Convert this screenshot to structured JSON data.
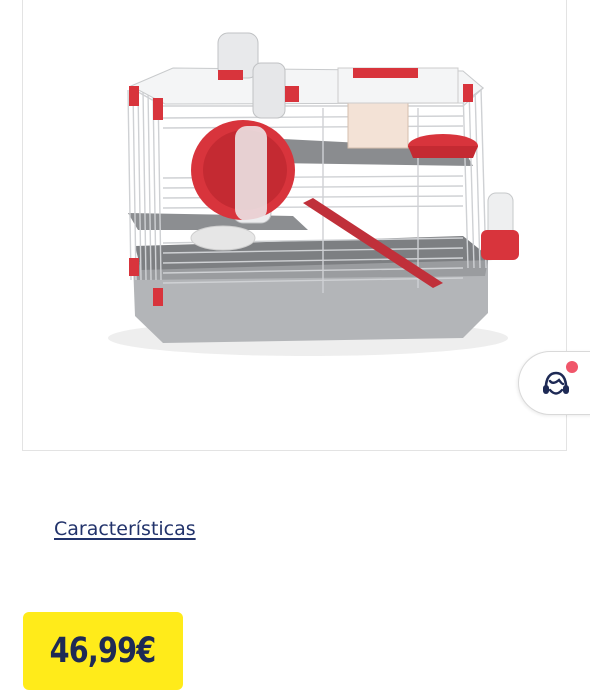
{
  "product": {
    "image_alt": "hamster-cage-red-white",
    "price": "46,99€"
  },
  "links": {
    "features_label": "Características"
  },
  "support": {
    "icon": "customer-support-icon",
    "has_notification": true
  },
  "colors": {
    "price_badge_bg": "#ffeb1a",
    "price_text": "#1e2a55",
    "link_text": "#22336b",
    "notification_dot": "#f0566a",
    "cage_red": "#d8343c",
    "cage_tray": "#a9abae"
  }
}
